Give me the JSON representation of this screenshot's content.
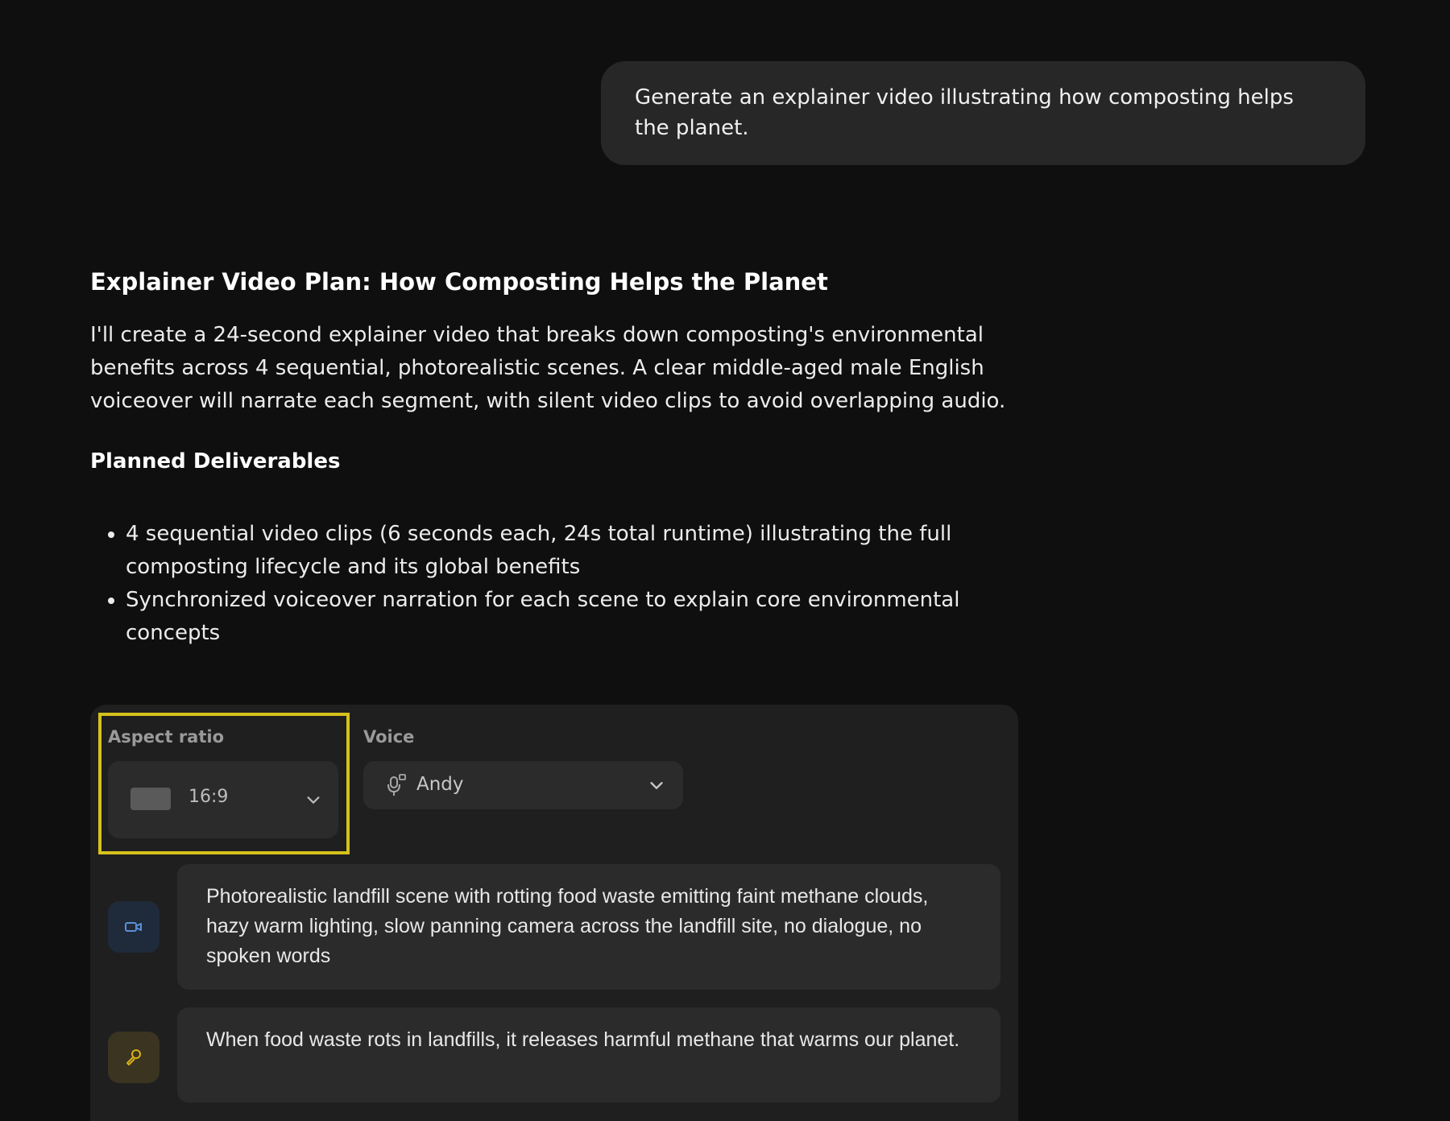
{
  "user_message": "Generate an explainer video illustrating how composting helps the planet.",
  "response": {
    "title": "Explainer Video Plan: How Composting Helps the Planet",
    "intro": "I'll create a 24-second explainer video that breaks down composting's environmental benefits across 4 sequential, photorealistic scenes. A clear middle-aged male English voiceover will narrate each segment, with silent video clips to avoid overlapping audio.",
    "deliverables_title": "Planned Deliverables",
    "deliverables": [
      "4 sequential video clips (6 seconds each, 24s total runtime) illustrating the full composting lifecycle and its global benefits",
      "Synchronized voiceover narration for each scene to explain core environmental concepts"
    ]
  },
  "settings": {
    "aspect_label": "Aspect ratio",
    "aspect_value": "16:9",
    "voice_label": "Voice",
    "voice_value": "Andy",
    "highlight_color": "#d6c21c"
  },
  "scenes": [
    {
      "type": "video",
      "icon": "video-camera-icon",
      "text": "Photorealistic landfill scene with rotting food waste emitting faint methane clouds, hazy warm lighting, slow panning camera across the landfill site, no dialogue, no spoken words"
    },
    {
      "type": "voiceover",
      "icon": "microphone-icon",
      "text": "When food waste rots in landfills, it releases harmful methane that warms our planet."
    }
  ]
}
